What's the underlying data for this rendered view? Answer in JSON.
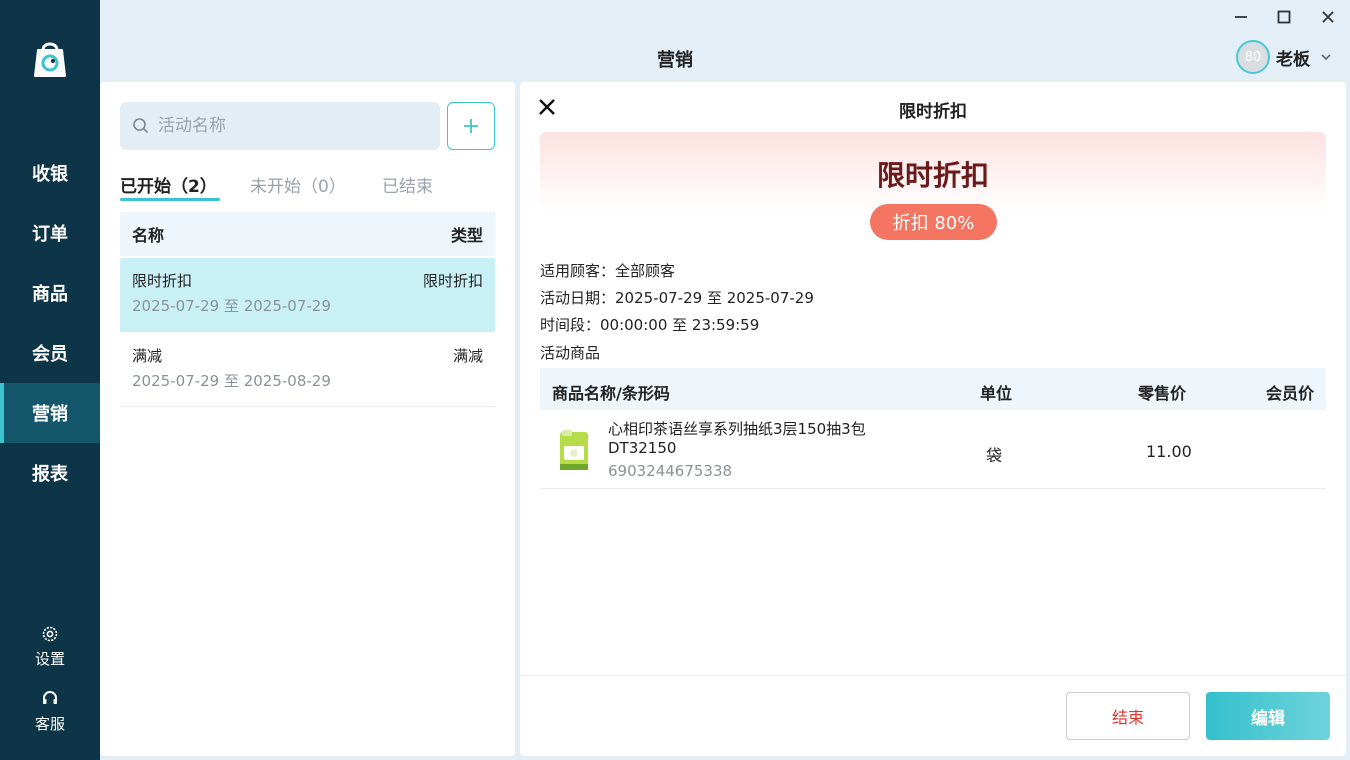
{
  "window": {
    "title": "营销"
  },
  "sidebar": {
    "items": [
      {
        "label": "收银"
      },
      {
        "label": "订单"
      },
      {
        "label": "商品"
      },
      {
        "label": "会员"
      },
      {
        "label": "营销",
        "active": true
      },
      {
        "label": "报表"
      }
    ],
    "bottom": [
      {
        "label": "设置",
        "icon": "gear-icon"
      },
      {
        "label": "客服",
        "icon": "headset-icon"
      }
    ]
  },
  "user": {
    "avatar_text": "80",
    "name": "老板"
  },
  "search": {
    "placeholder": "活动名称"
  },
  "tabs": [
    {
      "label": "已开始（2）",
      "active": true
    },
    {
      "label": "未开始（0）"
    },
    {
      "label": "已结束"
    }
  ],
  "list": {
    "headers": {
      "name": "名称",
      "type": "类型"
    },
    "rows": [
      {
        "name": "限时折扣",
        "type": "限时折扣",
        "dates": "2025-07-29 至 2025-07-29",
        "selected": true
      },
      {
        "name": "满减",
        "type": "满减",
        "dates": "2025-07-29 至 2025-08-29"
      }
    ]
  },
  "detail": {
    "title": "限时折扣",
    "promo_title": "限时折扣",
    "promo_badge": "折扣 80%",
    "customers": "适用顾客：全部顾客",
    "date_range": "活动日期：2025-07-29 至 2025-07-29",
    "time_range": "时间段：00:00:00 至 23:59:59",
    "goods_label": "活动商品",
    "goods_headers": {
      "name": "商品名称/条形码",
      "unit": "单位",
      "retail": "零售价",
      "member": "会员价"
    },
    "goods": [
      {
        "name_line1": "心相印茶语丝享系列抽纸3层150抽3包",
        "name_line2": "DT32150",
        "barcode": "6903244675338",
        "unit": "袋",
        "retail": "11.00",
        "member": ""
      }
    ],
    "buttons": {
      "end": "结束",
      "edit": "编辑"
    }
  },
  "colors": {
    "sidebar": "#0e3447",
    "accent": "#3cc3d0",
    "badge": "#f47561",
    "danger": "#e0322b"
  }
}
